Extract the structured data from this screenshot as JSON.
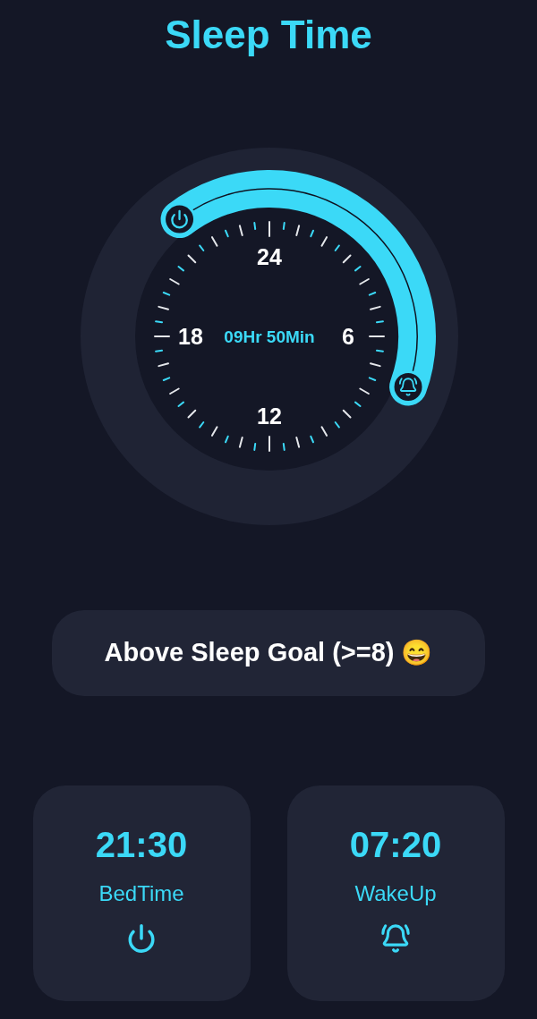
{
  "title": "Sleep Time",
  "dial": {
    "hour_labels": [
      "24",
      "6",
      "12",
      "18"
    ],
    "duration": "09Hr 50Min"
  },
  "status_message": {
    "text": "Above Sleep Goal (>=8)",
    "emoji": "😄"
  },
  "cards": [
    {
      "kind": "bedtime",
      "time": "21:30",
      "label": "BedTime"
    },
    {
      "kind": "wakeup",
      "time": "07:20",
      "label": "WakeUp"
    }
  ]
}
